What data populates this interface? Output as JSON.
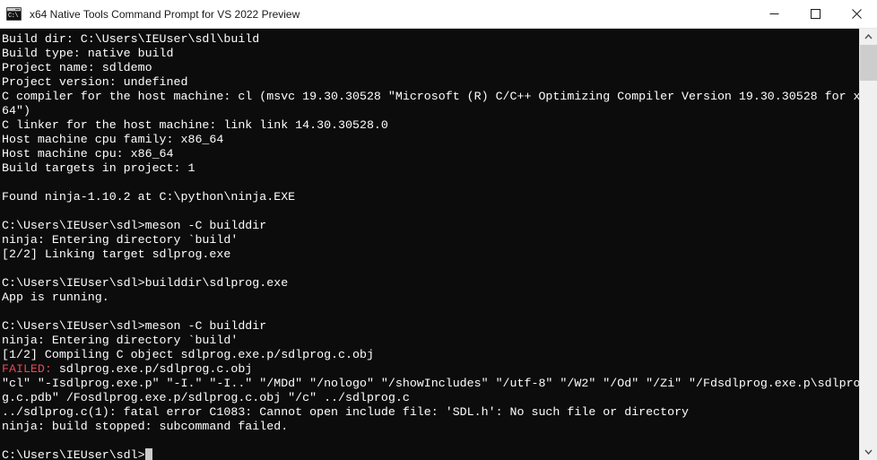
{
  "window": {
    "title": "x64 Native Tools Command Prompt for VS 2022 Preview",
    "icon": "console-icon",
    "icon_glyph": "C:\\",
    "controls": {
      "minimize_label": "Minimize",
      "maximize_label": "Maximize",
      "close_label": "Close"
    }
  },
  "colors": {
    "terminal_background": "#0c0c0c",
    "terminal_foreground": "#ffffff",
    "error_foreground": "#e74856",
    "titlebar_background": "#ffffff",
    "scrollbar_track": "#f0f0f0",
    "scrollbar_thumb": "#cdcdcd"
  },
  "terminal": {
    "lines": [
      {
        "text": "Build dir: C:\\Users\\IEUser\\sdl\\build"
      },
      {
        "text": "Build type: native build"
      },
      {
        "text": "Project name: sdldemo"
      },
      {
        "text": "Project version: undefined"
      },
      {
        "text": "C compiler for the host machine: cl (msvc 19.30.30528 \"Microsoft (R) C/C++ Optimizing Compiler Version 19.30.30528 for x"
      },
      {
        "text": "64\")"
      },
      {
        "text": "C linker for the host machine: link link 14.30.30528.0"
      },
      {
        "text": "Host machine cpu family: x86_64"
      },
      {
        "text": "Host machine cpu: x86_64"
      },
      {
        "text": "Build targets in project: 1"
      },
      {
        "text": ""
      },
      {
        "text": "Found ninja-1.10.2 at C:\\python\\ninja.EXE"
      },
      {
        "text": ""
      },
      {
        "text": "C:\\Users\\IEUser\\sdl>meson -C builddir"
      },
      {
        "text": "ninja: Entering directory `build'"
      },
      {
        "text": "[2/2] Linking target sdlprog.exe"
      },
      {
        "text": ""
      },
      {
        "text": "C:\\Users\\IEUser\\sdl>builddir\\sdlprog.exe"
      },
      {
        "text": "App is running."
      },
      {
        "text": ""
      },
      {
        "text": "C:\\Users\\IEUser\\sdl>meson -C builddir"
      },
      {
        "text": "ninja: Entering directory `build'"
      },
      {
        "text": "[1/2] Compiling C object sdlprog.exe.p/sdlprog.c.obj"
      },
      {
        "error_prefix": "FAILED:",
        "text": " sdlprog.exe.p/sdlprog.c.obj"
      },
      {
        "text": "\"cl\" \"-Isdlprog.exe.p\" \"-I.\" \"-I..\" \"/MDd\" \"/nologo\" \"/showIncludes\" \"/utf-8\" \"/W2\" \"/Od\" \"/Zi\" \"/Fdsdlprog.exe.p\\sdlpro"
      },
      {
        "text": "g.c.pdb\" /Fosdlprog.exe.p/sdlprog.c.obj \"/c\" ../sdlprog.c"
      },
      {
        "text": "../sdlprog.c(1): fatal error C1083: Cannot open include file: 'SDL.h': No such file or directory"
      },
      {
        "text": "ninja: build stopped: subcommand failed."
      },
      {
        "text": ""
      }
    ],
    "prompt": "C:\\Users\\IEUser\\sdl>",
    "cursor": "block"
  },
  "scrollbar": {
    "up_arrow": "chevron-up-icon",
    "down_arrow": "chevron-down-icon",
    "thumb_position": "top"
  }
}
